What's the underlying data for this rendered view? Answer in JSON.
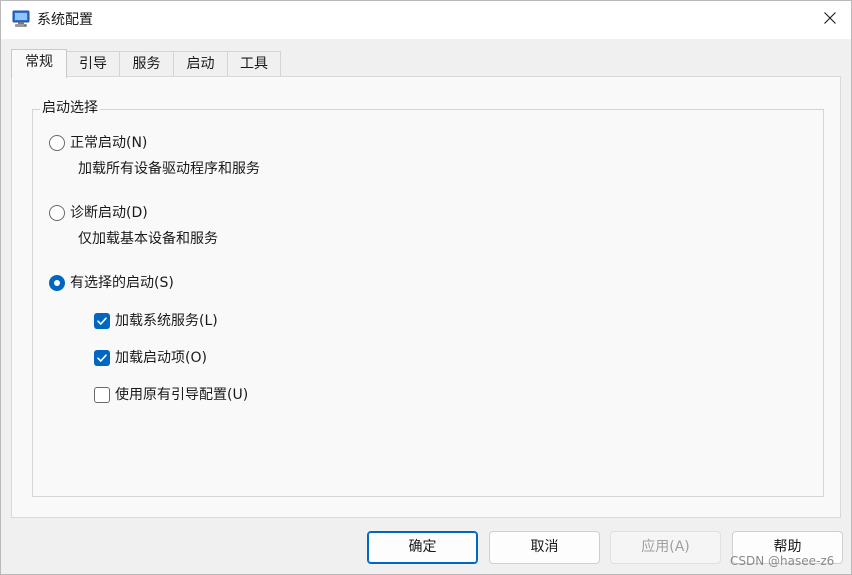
{
  "window": {
    "title": "系统配置",
    "icon": "msconfig-icon",
    "close_icon": "close-icon"
  },
  "tabs": [
    {
      "label": "常规",
      "active": true
    },
    {
      "label": "引导",
      "active": false
    },
    {
      "label": "服务",
      "active": false
    },
    {
      "label": "启动",
      "active": false
    },
    {
      "label": "工具",
      "active": false
    }
  ],
  "startup_selection": {
    "legend": "启动选择",
    "options": [
      {
        "label": "正常启动(N)",
        "description": "加载所有设备驱动程序和服务",
        "checked": false
      },
      {
        "label": "诊断启动(D)",
        "description": "仅加载基本设备和服务",
        "checked": false
      },
      {
        "label": "有选择的启动(S)",
        "description": "",
        "checked": true
      }
    ],
    "selective_options": [
      {
        "label": "加载系统服务(L)",
        "checked": true
      },
      {
        "label": "加载启动项(O)",
        "checked": true
      },
      {
        "label": "使用原有引导配置(U)",
        "checked": false
      }
    ]
  },
  "buttons": {
    "ok": "确定",
    "cancel": "取消",
    "apply": "应用(A)",
    "help": "帮助"
  },
  "watermark": "CSDN @hasee-z6",
  "colors": {
    "accent": "#0067c0",
    "background": "#f0f0f0",
    "panel": "#f9f9f9"
  }
}
